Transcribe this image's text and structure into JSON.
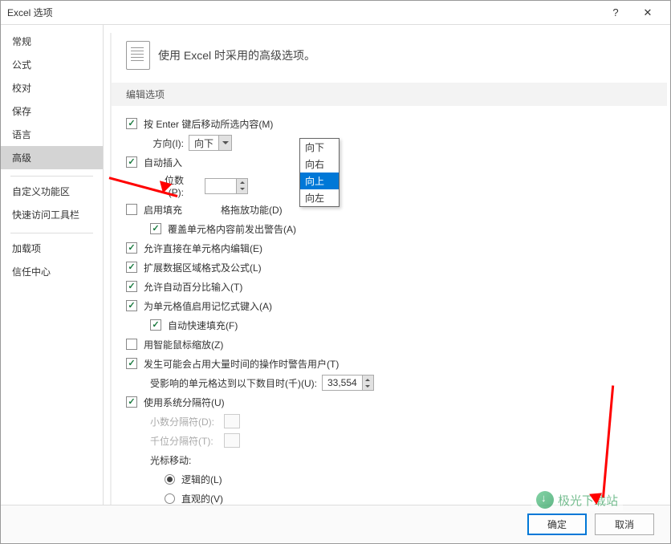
{
  "window": {
    "title": "Excel 选项",
    "help": "?",
    "close": "✕"
  },
  "sidebar": {
    "group1": [
      "常规",
      "公式",
      "校对",
      "保存",
      "语言",
      "高级"
    ],
    "group2": [
      "自定义功能区",
      "快速访问工具栏"
    ],
    "group3": [
      "加载项",
      "信任中心"
    ],
    "active_index": 5
  },
  "header": {
    "text": "使用 Excel 时采用的高级选项。"
  },
  "section": {
    "title": "编辑选项"
  },
  "opts": {
    "enter_move": "按 Enter 键后移动所选内容(M)",
    "direction_label": "方向(I):",
    "direction_value": "向下",
    "dropdown": [
      "向下",
      "向右",
      "向上",
      "向左"
    ],
    "dropdown_selected_index": 2,
    "auto_insert": "自动插入",
    "digits_label": "位数(P):",
    "enable_fill": "启用填充",
    "enable_fill_suffix": "格拖放功能(D)",
    "overwrite_warn": "覆盖单元格内容前发出警告(A)",
    "allow_edit": "允许直接在单元格内编辑(E)",
    "extend_fmt": "扩展数据区域格式及公式(L)",
    "allow_pct": "允许自动百分比输入(T)",
    "memo_input": "为单元格值启用记忆式键入(A)",
    "flash_fill": "自动快速填充(F)",
    "intelli_zoom": "用智能鼠标缩放(Z)",
    "warn_long_op": "发生可能会占用大量时间的操作时警告用户(T)",
    "affected_cells_label": "受影响的单元格达到以下数目时(千)(U):",
    "affected_cells_value": "33,554",
    "use_sys_sep": "使用系统分隔符(U)",
    "decimal_sep_label": "小数分隔符(D):",
    "thousand_sep_label": "千位分隔符(T):",
    "cursor_move_label": "光标移动:",
    "logical": "逻辑的(L)",
    "intuitive": "直观的(V)"
  },
  "footer": {
    "ok": "确定",
    "cancel": "取消"
  },
  "watermark": {
    "text": "极光下载站"
  }
}
